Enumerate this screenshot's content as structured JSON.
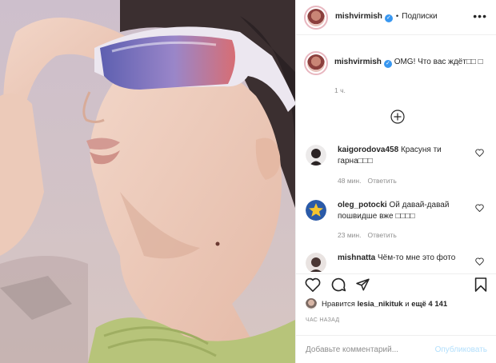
{
  "header": {
    "username": "mishvirmish",
    "follow_label": "Подписки",
    "separator": "•",
    "more_label": "•••"
  },
  "caption": {
    "username": "mishvirmish",
    "text": "OMG! Что вас ждёт□□ □",
    "time": "1 ч."
  },
  "comments": [
    {
      "username": "kaigorodova458",
      "text": "Красуня ти гарна□□□",
      "time": "48 мин.",
      "reply": "Ответить"
    },
    {
      "username": "oleg_potocki",
      "text": "Ой давай-давай пошвидше вже □□□□",
      "time": "23 мин.",
      "reply": "Ответить"
    },
    {
      "username": "mishnatta",
      "text": "Чём-то мне это фото"
    }
  ],
  "likes": {
    "prefix": "Нравится",
    "user": "lesia_nikituk",
    "middle": "и",
    "count": "ещё 4 141"
  },
  "post_time": "ЧАС НАЗАД",
  "add_comment": {
    "placeholder": "Добавьте комментарий...",
    "publish_label": "Опубликовать"
  },
  "colors": {
    "verified": "#3897f0",
    "publish_disabled": "#b2dffc",
    "secondary_text": "#8e8e8e"
  }
}
